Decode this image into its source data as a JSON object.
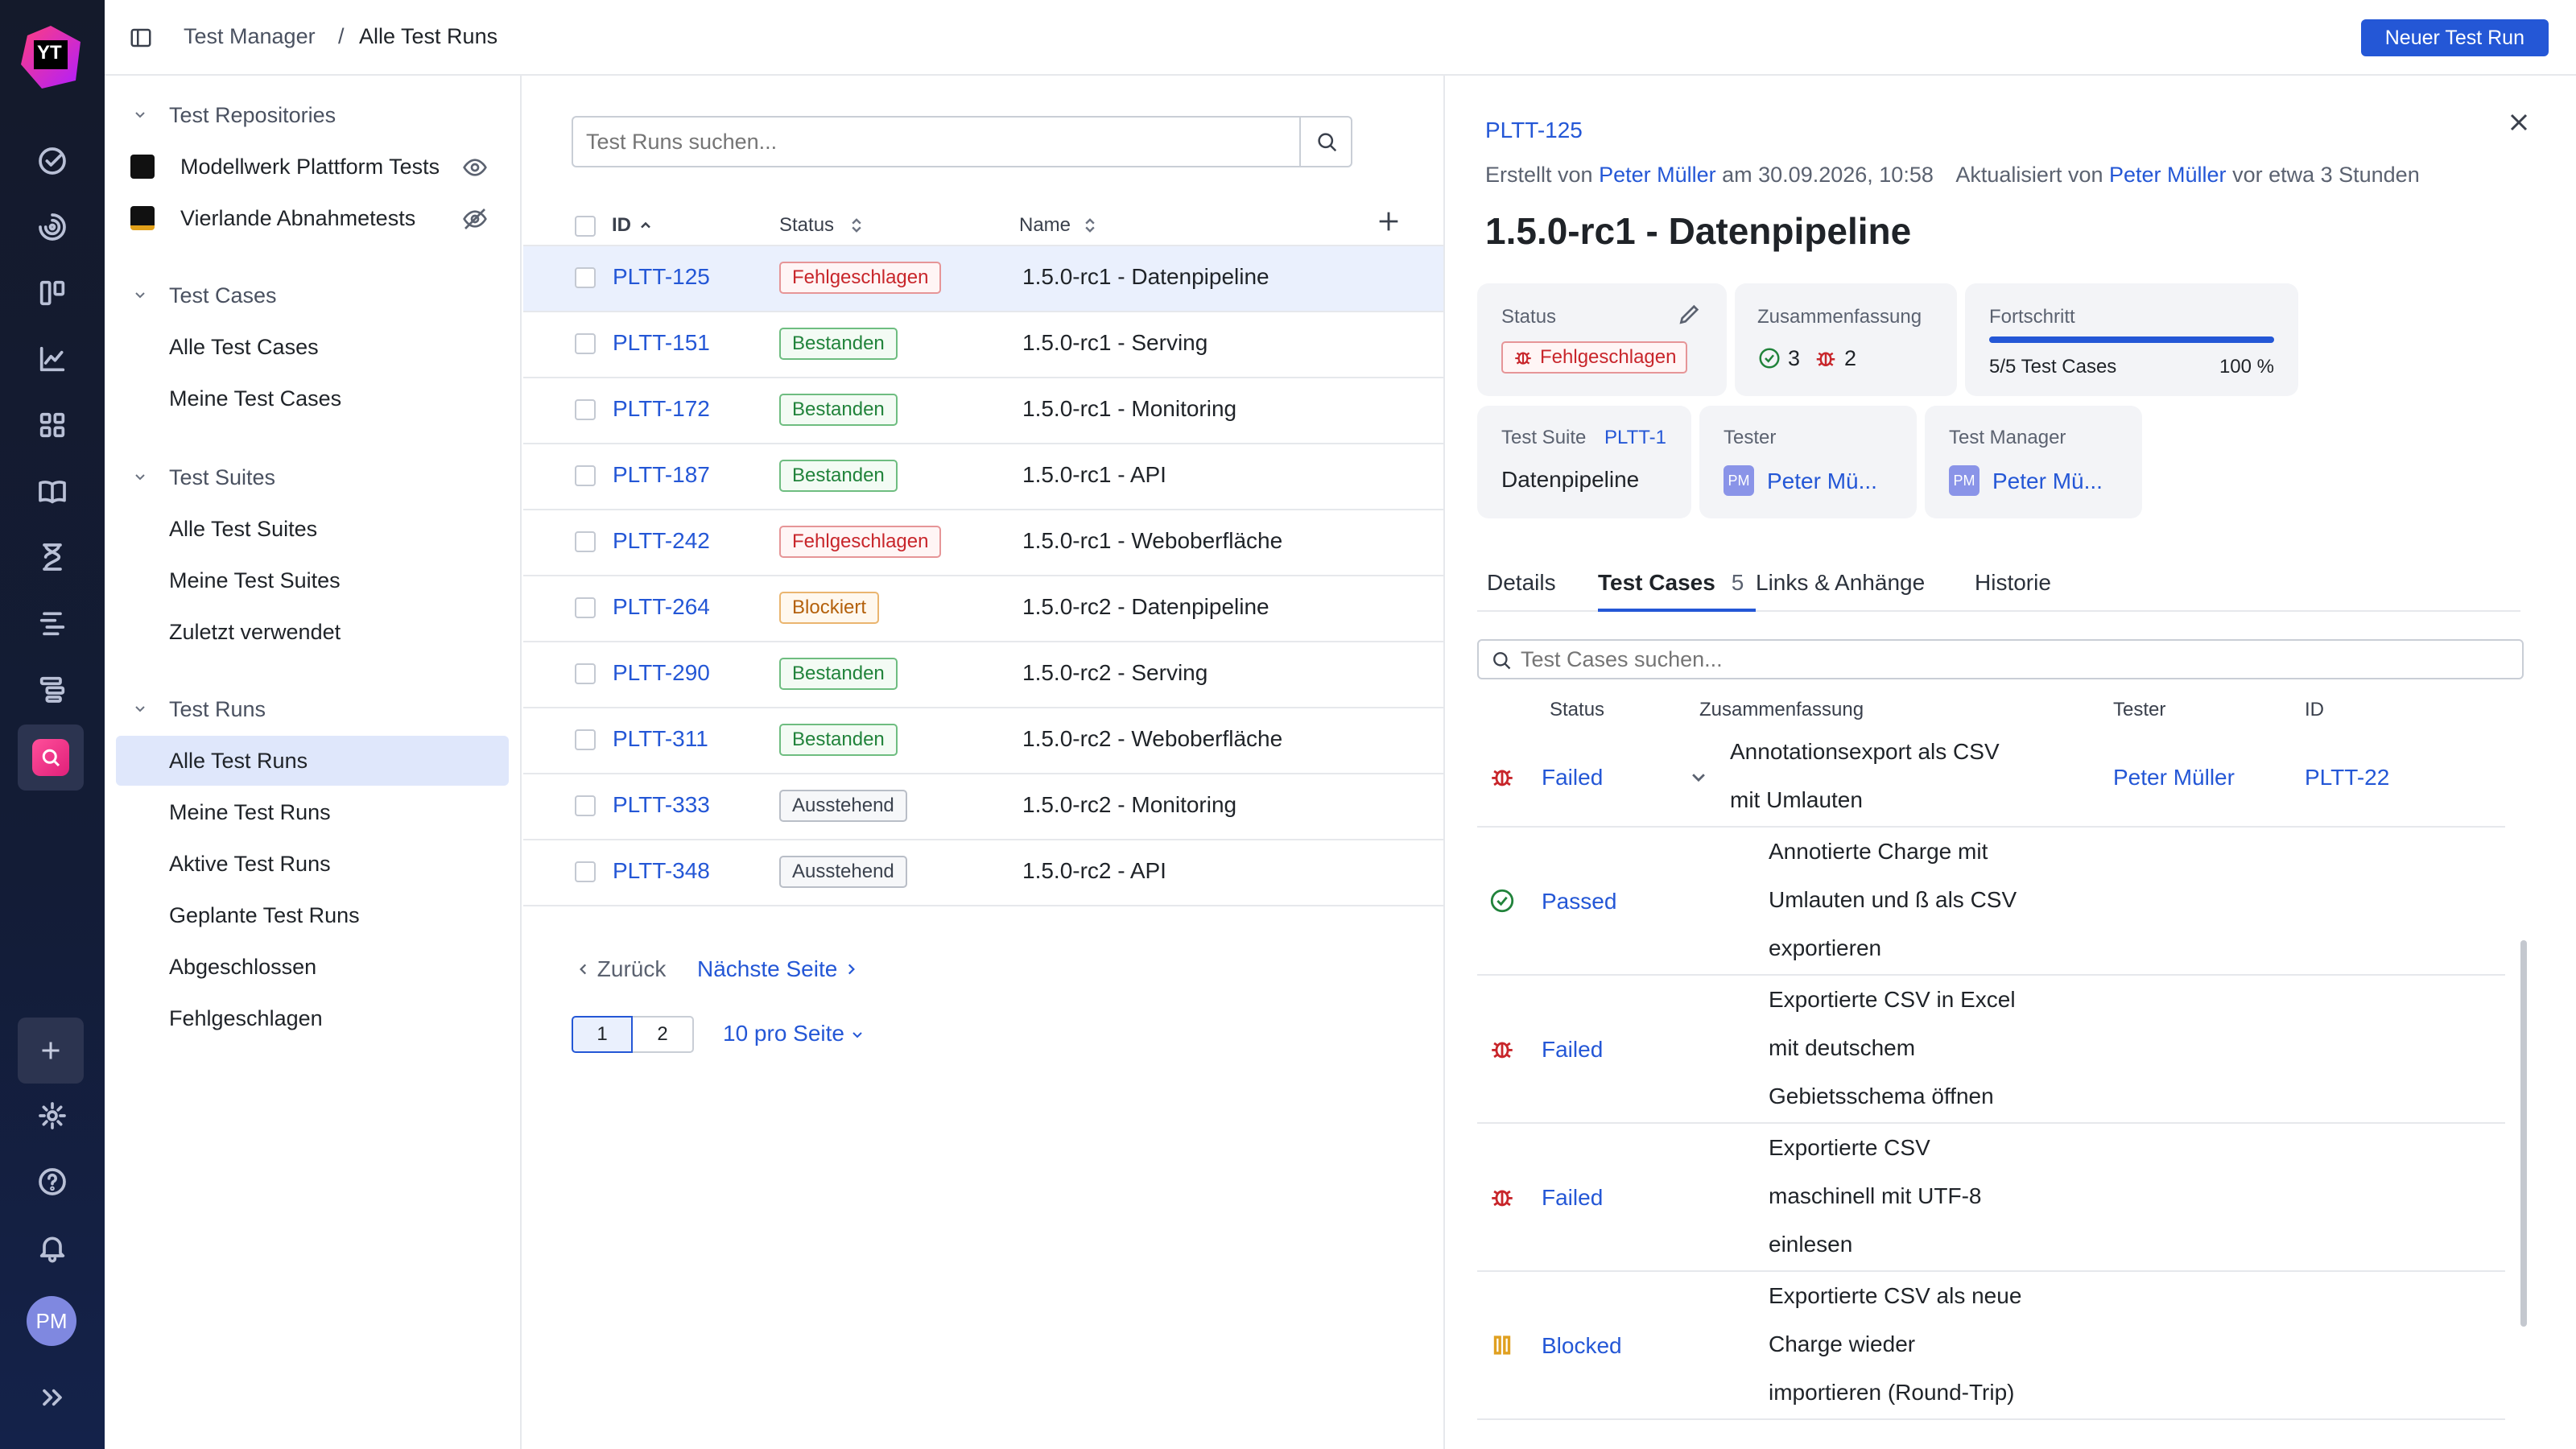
{
  "app": {
    "logo_text": "YT"
  },
  "header": {
    "breadcrumb_root": "Test Manager",
    "breadcrumb_sep": "/",
    "breadcrumb_current": "Alle Test Runs",
    "new_button": "Neuer Test Run"
  },
  "sidebar": {
    "repos_title": "Test Repositories",
    "repos": [
      {
        "label": "Modellwerk Plattform Tests",
        "icon": "eye-icon"
      },
      {
        "label": "Vierlande Abnahmetests",
        "icon": "eye-off-icon"
      }
    ],
    "cases_title": "Test Cases",
    "cases": [
      "Alle Test Cases",
      "Meine Test Cases"
    ],
    "suites_title": "Test Suites",
    "suites": [
      "Alle Test Suites",
      "Meine Test Suites",
      "Zuletzt verwendet"
    ],
    "runs_title": "Test Runs",
    "runs": [
      "Alle Test Runs",
      "Meine Test Runs",
      "Aktive Test Runs",
      "Geplante Test Runs",
      "Abgeschlossen",
      "Fehlgeschlagen"
    ],
    "user_initials": "PM"
  },
  "list": {
    "search_placeholder": "Test Runs suchen...",
    "col_id": "ID",
    "col_status": "Status",
    "col_name": "Name",
    "rows": [
      {
        "id": "PLTT-125",
        "status": "Fehlgeschlagen",
        "kind": "fail",
        "name": "1.5.0-rc1 - Datenpipeline"
      },
      {
        "id": "PLTT-151",
        "status": "Bestanden",
        "kind": "pass",
        "name": "1.5.0-rc1 - Serving"
      },
      {
        "id": "PLTT-172",
        "status": "Bestanden",
        "kind": "pass",
        "name": "1.5.0-rc1 - Monitoring"
      },
      {
        "id": "PLTT-187",
        "status": "Bestanden",
        "kind": "pass",
        "name": "1.5.0-rc1 - API"
      },
      {
        "id": "PLTT-242",
        "status": "Fehlgeschlagen",
        "kind": "fail",
        "name": "1.5.0-rc1 - Weboberfläche"
      },
      {
        "id": "PLTT-264",
        "status": "Blockiert",
        "kind": "block",
        "name": "1.5.0-rc2 - Datenpipeline"
      },
      {
        "id": "PLTT-290",
        "status": "Bestanden",
        "kind": "pass",
        "name": "1.5.0-rc2 - Serving"
      },
      {
        "id": "PLTT-311",
        "status": "Bestanden",
        "kind": "pass",
        "name": "1.5.0-rc2 - Weboberfläche"
      },
      {
        "id": "PLTT-333",
        "status": "Ausstehend",
        "kind": "pend",
        "name": "1.5.0-rc2 - Monitoring"
      },
      {
        "id": "PLTT-348",
        "status": "Ausstehend",
        "kind": "pend",
        "name": "1.5.0-rc2 - API"
      }
    ],
    "prev": "Zurück",
    "next": "Nächste Seite",
    "pages": [
      "1",
      "2"
    ],
    "per_page": "10 pro Seite"
  },
  "detail": {
    "id": "PLTT-125",
    "created_prefix": "Erstellt von",
    "created_by": "Peter Müller",
    "created_on": "am 30.09.2026, 10:58",
    "updated_prefix": "Aktualisiert von",
    "updated_by": "Peter Müller",
    "updated_when": "vor etwa 3 Stunden",
    "title": "1.5.0-rc1 - Datenpipeline",
    "status_label": "Status",
    "status_value": "Fehlgeschlagen",
    "summary_label": "Zusammenfassung",
    "passed_count": "3",
    "failed_count": "2",
    "progress_label": "Fortschritt",
    "progress_text": "5/5 Test Cases",
    "progress_pct": "100 %",
    "progress_fraction": 1.0,
    "suite_label": "Test Suite",
    "suite_id": "PLTT-1",
    "suite_name": "Datenpipeline",
    "tester_label": "Tester",
    "tester_name": "Peter Mü...",
    "manager_label": "Test Manager",
    "manager_name": "Peter Mü...",
    "tabs": [
      "Details",
      "Test Cases",
      "Links & Anhänge",
      "Historie"
    ],
    "tab_count": "5",
    "tc_search_placeholder": "Test Cases suchen...",
    "tc_col_status": "Status",
    "tc_col_summary": "Zusammenfassung",
    "tc_col_tester": "Tester",
    "tc_col_id": "ID",
    "test_cases": [
      {
        "status": "Failed",
        "kind": "fail",
        "lines": [
          "Annotationsexport als CSV",
          "mit Umlauten"
        ],
        "tester": "Peter Müller",
        "id": "PLTT-22"
      },
      {
        "status": "Passed",
        "kind": "pass",
        "lines": [
          "Annotierte Charge mit",
          "Umlauten und ß als CSV",
          "exportieren"
        ]
      },
      {
        "status": "Failed",
        "kind": "fail",
        "lines": [
          "Exportierte CSV in Excel",
          "mit deutschem",
          "Gebietsschema öffnen"
        ]
      },
      {
        "status": "Failed",
        "kind": "fail",
        "lines": [
          "Exportierte CSV",
          "maschinell mit UTF-8",
          "einlesen"
        ]
      },
      {
        "status": "Blocked",
        "kind": "block",
        "lines": [
          "Exportierte CSV als neue",
          "Charge wieder",
          "importieren (Round-Trip)"
        ]
      }
    ]
  },
  "colors": {
    "accent": "#2457d6",
    "fail": "#c8262b",
    "pass": "#21833b",
    "block": "#e0a020",
    "rail": "#141a2b"
  }
}
